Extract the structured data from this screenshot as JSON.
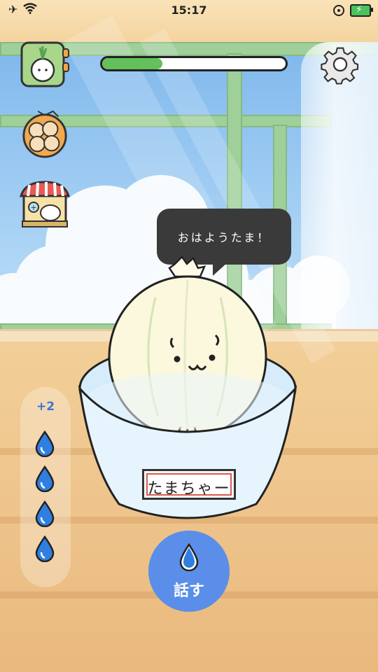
{
  "status": {
    "time": "15:17"
  },
  "growth": {
    "progress": 0.33
  },
  "speech": {
    "text": "おはようたま！"
  },
  "pet": {
    "name": "たまちゃー"
  },
  "water": {
    "count_label": "+2",
    "drops_remaining": 4
  },
  "talk_button": {
    "label": "話す"
  },
  "colors": {
    "progress_fill": "#63c05a",
    "talk_button": "#5a8ee8",
    "water_drop": "#2f7fe0",
    "bubble": "#3a3a3a",
    "label_border": "#d85a52"
  },
  "icons": {
    "top_left": "onion-sprout-card-icon",
    "second": "onion-bag-icon",
    "third": "shop-icon",
    "settings": "gear-icon"
  }
}
